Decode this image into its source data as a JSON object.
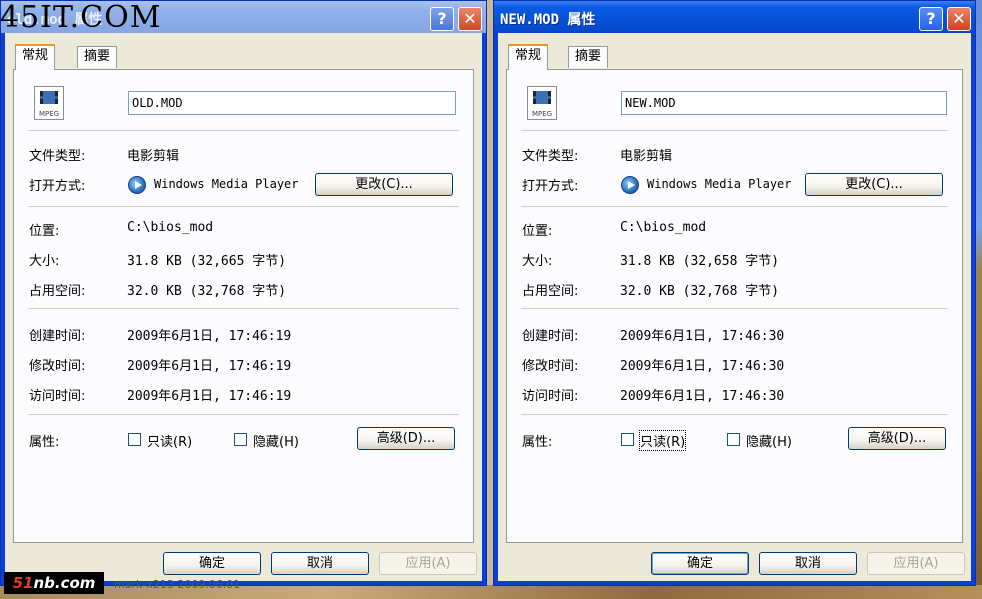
{
  "watermarks": {
    "top_left": "45IT.COM",
    "logo_prefix": "51",
    "logo_suffix": "nb.com",
    "bottom": "mark-x213 2009.06.01"
  },
  "colors": {
    "title_active": "#0650d8",
    "title_inactive": "#86a7e4",
    "tab_highlight": "#e69d1e",
    "dialog_bg": "#ece9d8"
  },
  "dialogs": [
    {
      "title": "OLD.MOD 属性",
      "title_visible": "old.mod 属性",
      "active": false,
      "tabs": [
        "常规",
        "摘要"
      ],
      "file_name": "OLD.MOD",
      "icon": "mpeg-file-icon",
      "icon_label": "MPEG",
      "file_type_label": "文件类型:",
      "file_type": "电影剪辑",
      "open_with_label": "打开方式:",
      "open_with": "Windows Media Player",
      "change_button": "更改(C)...",
      "location_label": "位置:",
      "location": "C:\\bios_mod",
      "size_label": "大小:",
      "size": "31.8 KB (32,665 字节)",
      "size_on_disk_label": "占用空间:",
      "size_on_disk": "32.0 KB (32,768 字节)",
      "created_label": "创建时间:",
      "created": "2009年6月1日, 17:46:19",
      "modified_label": "修改时间:",
      "modified": "2009年6月1日, 17:46:19",
      "accessed_label": "访问时间:",
      "accessed": "2009年6月1日, 17:46:19",
      "attributes_label": "属性:",
      "readonly_label": "只读(R)",
      "hidden_label": "隐藏(H)",
      "advanced_button": "高级(D)...",
      "ok_button": "确定",
      "cancel_button": "取消",
      "apply_button": "应用(A)"
    },
    {
      "title": "NEW.MOD 属性",
      "active": true,
      "tabs": [
        "常规",
        "摘要"
      ],
      "file_name": "NEW.MOD",
      "icon": "mpeg-file-icon",
      "icon_label": "MPEG",
      "file_type_label": "文件类型:",
      "file_type": "电影剪辑",
      "open_with_label": "打开方式:",
      "open_with": "Windows Media Player",
      "change_button": "更改(C)...",
      "location_label": "位置:",
      "location": "C:\\bios_mod",
      "size_label": "大小:",
      "size": "31.8 KB (32,658 字节)",
      "size_on_disk_label": "占用空间:",
      "size_on_disk": "32.0 KB (32,768 字节)",
      "created_label": "创建时间:",
      "created": "2009年6月1日, 17:46:30",
      "modified_label": "修改时间:",
      "modified": "2009年6月1日, 17:46:30",
      "accessed_label": "访问时间:",
      "accessed": "2009年6月1日, 17:46:30",
      "attributes_label": "属性:",
      "readonly_label": "只读(R)",
      "hidden_label": "隐藏(H)",
      "advanced_button": "高级(D)...",
      "ok_button": "确定",
      "cancel_button": "取消",
      "apply_button": "应用(A)"
    }
  ]
}
